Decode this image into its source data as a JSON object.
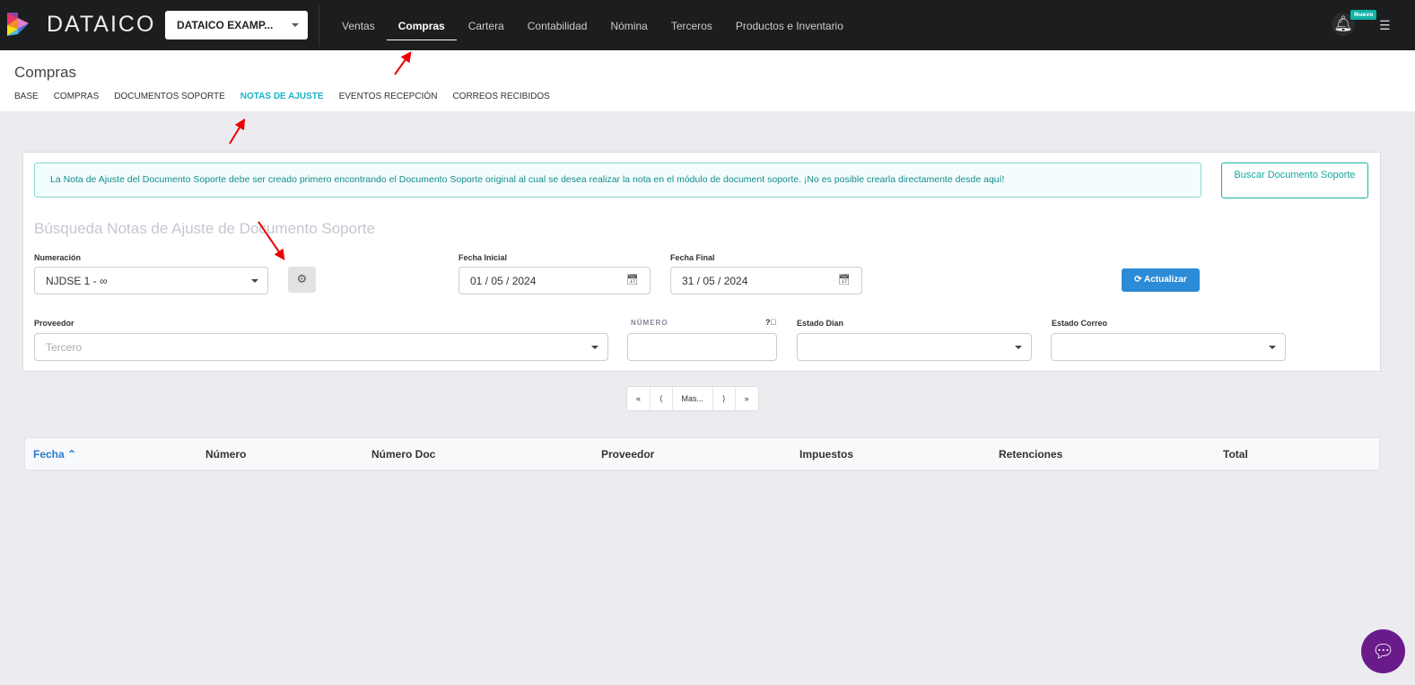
{
  "nav": {
    "brand": "DATAICO",
    "company": "DATAICO EXAMP...",
    "menu": [
      "Ventas",
      "Compras",
      "Cartera",
      "Contabilidad",
      "Nómina",
      "Terceros",
      "Productos e Inventario"
    ],
    "active": "Compras",
    "badge": "Nuevo"
  },
  "sub": {
    "title": "Compras",
    "tabs": [
      "BASE",
      "COMPRAS",
      "DOCUMENTOS SOPORTE",
      "NOTAS DE AJUSTE",
      "EVENTOS RECEPCIÓN",
      "CORREOS RECIBIDOS"
    ]
  },
  "alert": "La Nota de Ajuste del Documento Soporte debe ser creado primero encontrando el Documento Soporte original al cual se desea realizar la nota en el módulo de document soporte. ¡No es posible crearla directamente desde aquí!",
  "buscar_btn": "Buscar Documento Soporte",
  "search": {
    "title": "Búsqueda Notas de Ajuste de Documento Soporte",
    "numeracion_label": "Numeración",
    "numeracion_value": "NJDSE 1 - ∞",
    "fecha_inicial_label": "Fecha Inicial",
    "fecha_inicial": "01 / 05 / 2024",
    "fecha_final_label": "Fecha Final",
    "fecha_final": "31 / 05 / 2024",
    "actualizar": "Actualizar",
    "proveedor_label": "Proveedor",
    "proveedor_placeholder": "Tercero",
    "numero_label": "NÚMERO",
    "estado_dian_label": "Estado Dian",
    "estado_correo_label": "Estado Correo"
  },
  "pager": [
    "«",
    "⟨",
    "Mas...",
    "⟩",
    "»"
  ],
  "table": {
    "columns": [
      "Fecha ⌃",
      "Número",
      "Número Doc",
      "Proveedor",
      "Impuestos",
      "Retenciones",
      "Total"
    ]
  },
  "colors": {
    "accent": "#13b3a6",
    "primary": "#2b8bd6",
    "nav": "#1c1d1f"
  }
}
